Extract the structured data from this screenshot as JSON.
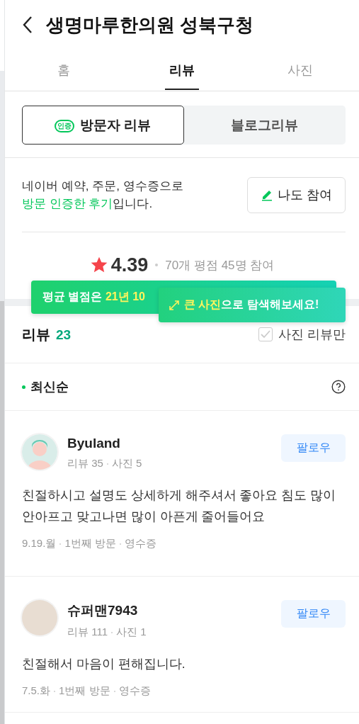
{
  "header": {
    "title": "생명마루한의원 성북구청"
  },
  "tabs": [
    {
      "label": "홈",
      "selected": false
    },
    {
      "label": "리뷰",
      "selected": true
    },
    {
      "label": "사진",
      "selected": false
    }
  ],
  "review_types": [
    {
      "label": "방문자 리뷰",
      "badge": "인증",
      "selected": true
    },
    {
      "label": "블로그리뷰",
      "selected": false
    }
  ],
  "notice": {
    "text_before": "네이버 예약, 주문, 영수증으로",
    "highlight": "방문 인증한 후기",
    "text_after": "입니다.",
    "button": "나도 참여"
  },
  "rating": {
    "score": "4.39",
    "summary": "70개 평점 45명 참여"
  },
  "tooltips": [
    {
      "parts": [
        {
          "text": "평균 별점은 ",
          "highlight": false
        },
        {
          "text": "21년 10",
          "highlight": true
        }
      ]
    },
    {
      "parts": [
        {
          "text": "큰 사진",
          "highlight": true
        },
        {
          "text": "으로 탐색해보세요!",
          "highlight": false
        }
      ]
    }
  ],
  "reviews_header": {
    "title": "리뷰",
    "count": "23",
    "photo_only": {
      "label": "사진 리뷰만",
      "checked": false
    }
  },
  "sort": {
    "label": "최신순"
  },
  "reviews": [
    {
      "kind": "illustration",
      "author": "Byuland",
      "stats": [
        "리뷰 35",
        "사진 5"
      ],
      "follow": "팔로우",
      "text": "친절하시고 설명도 상세하게 해주셔서 좋아요 침도 많이 안아프고 맞고나면 많이 아픈게 줄어들어요",
      "meta": [
        "9.19.월",
        "1번째 방문",
        "영수증"
      ]
    },
    {
      "kind": "photo",
      "author": "슈퍼맨7943",
      "stats": [
        "리뷰 111",
        "사진 1"
      ],
      "follow": "팔로우",
      "text": "친절해서 마음이 편해집니다.",
      "meta": [
        "7.5.화",
        "1번째 방문",
        "영수증"
      ]
    }
  ]
}
